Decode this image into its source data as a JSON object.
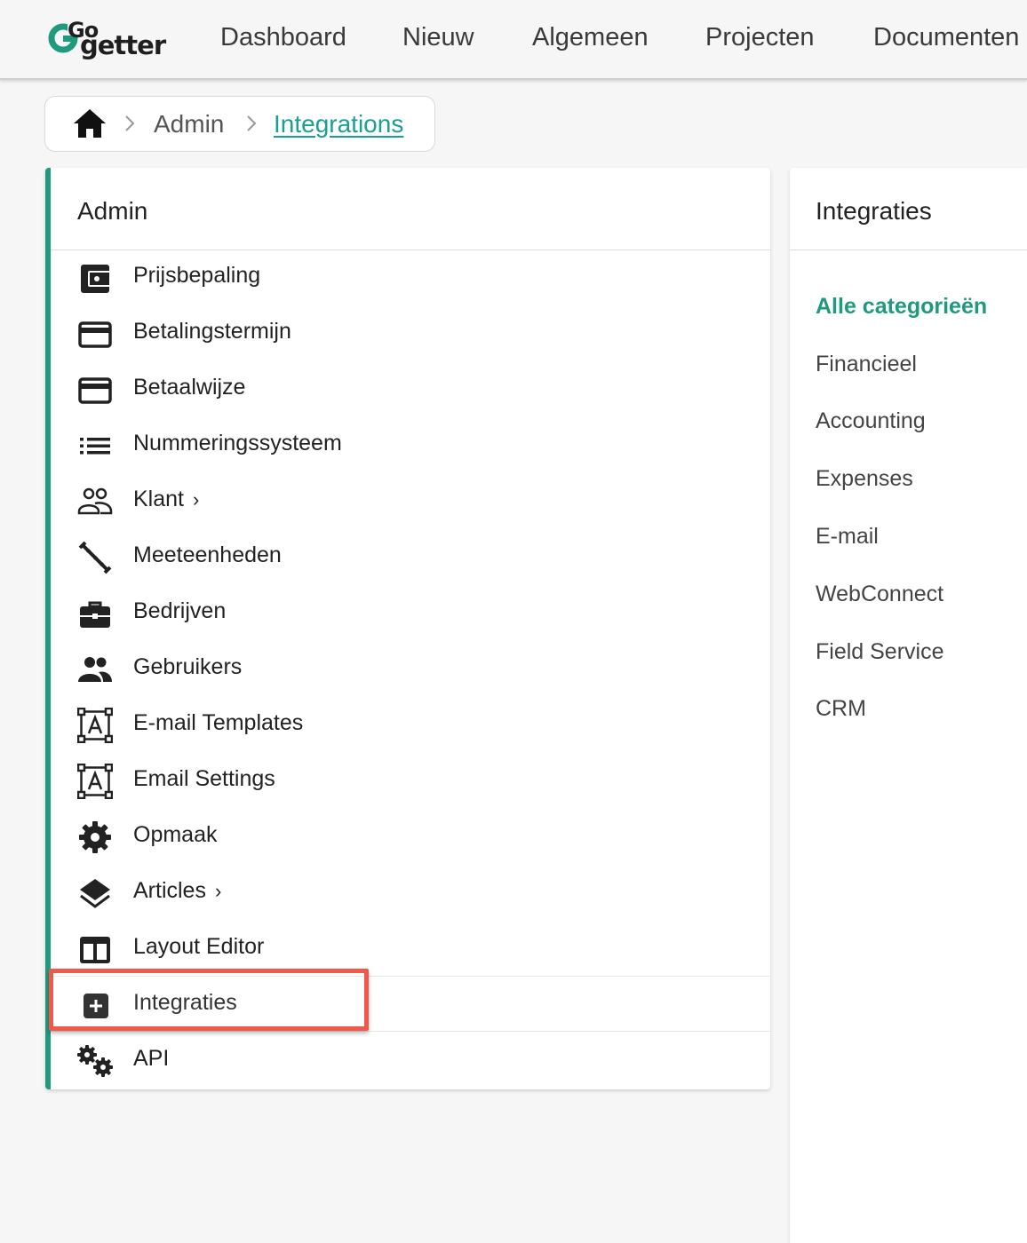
{
  "nav": {
    "logo_small": "Go",
    "logo_big": "getter",
    "items": [
      "Dashboard",
      "Nieuw",
      "Algemeen",
      "Projecten",
      "Documenten"
    ]
  },
  "breadcrumb": {
    "admin": "Admin",
    "current": "Integrations"
  },
  "admin_panel": {
    "title": "Admin",
    "items": [
      {
        "label": "Prijsbepaling",
        "icon": "wallet-icon"
      },
      {
        "label": "Betalingstermijn",
        "icon": "credit-card-icon"
      },
      {
        "label": "Betaalwijze",
        "icon": "credit-card-icon"
      },
      {
        "label": "Nummeringssysteem",
        "icon": "list-icon"
      },
      {
        "label": "Klant",
        "icon": "people-outline-icon",
        "chevron": "›"
      },
      {
        "label": "Meeteenheden",
        "icon": "ruler-icon"
      },
      {
        "label": "Bedrijven",
        "icon": "briefcase-icon"
      },
      {
        "label": "Gebruikers",
        "icon": "people-icon"
      },
      {
        "label": "E-mail Templates",
        "icon": "text-frame-icon"
      },
      {
        "label": "Email Settings",
        "icon": "text-frame-icon"
      },
      {
        "label": "Opmaak",
        "icon": "gear-icon"
      },
      {
        "label": "Articles",
        "icon": "layers-icon",
        "chevron": "›"
      },
      {
        "label": "Layout Editor",
        "icon": "columns-icon"
      },
      {
        "label": "Integraties",
        "icon": "plus-box-icon"
      },
      {
        "label": "API",
        "icon": "gears-icon"
      }
    ]
  },
  "right_panel": {
    "title": "Integraties",
    "categories": [
      "Alle categorieën",
      "Financieel",
      "Accounting",
      "Expenses",
      "E-mail",
      "WebConnect",
      "Field Service",
      "CRM"
    ],
    "active_category": "Alle categorieën"
  },
  "colors": {
    "accent": "#1f9a7f",
    "link": "#1aa092",
    "highlight": "#f0584a"
  }
}
